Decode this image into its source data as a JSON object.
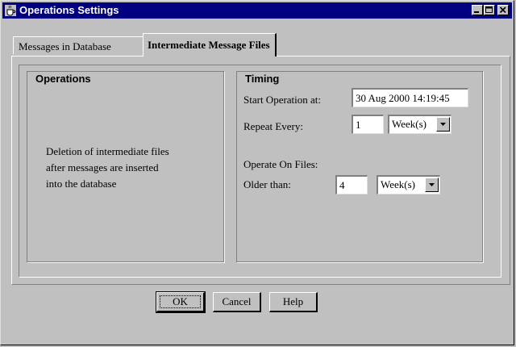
{
  "window": {
    "title": "Operations Settings",
    "icon": "java-coffee-icon",
    "controls": [
      "minimize-icon",
      "maximize-icon",
      "close-icon"
    ]
  },
  "tabs": [
    {
      "label": "Messages in Database",
      "active": false
    },
    {
      "label": "Intermediate Message Files",
      "active": true
    }
  ],
  "operations": {
    "title": "Operations",
    "description_lines": [
      "Deletion of intermediate files",
      "after messages are inserted",
      "into the database"
    ]
  },
  "timing": {
    "title": "Timing",
    "start_label": "Start Operation at:",
    "start_value": "30 Aug 2000 14:19:45",
    "repeat_label": "Repeat Every:",
    "repeat_value": "1",
    "repeat_unit": "Week(s)",
    "operate_label": "Operate On Files:",
    "older_label": "Older than:",
    "older_value": "4",
    "older_unit": "Week(s)"
  },
  "buttons": {
    "ok": "OK",
    "cancel": "Cancel",
    "help": "Help"
  },
  "colors": {
    "titlebar": "#000080",
    "face": "#c0c0c0"
  }
}
